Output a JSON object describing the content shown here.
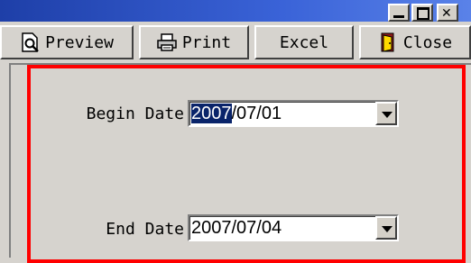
{
  "toolbar": {
    "preview_label": "Preview",
    "print_label": "Print",
    "excel_label": "Excel",
    "close_label": "Close"
  },
  "form": {
    "begin_date": {
      "label": "Begin Date",
      "value_selected": "2007",
      "value_rest": "/07/01"
    },
    "end_date": {
      "label": "End Date",
      "value": "2007/07/04"
    }
  },
  "colors": {
    "title_bar": "#1e3fa8",
    "highlight_border": "#ff0000",
    "selection": "#0a246a"
  },
  "icons": [
    "preview-icon",
    "print-icon",
    "close-door-icon",
    "dropdown-arrow-icon",
    "minimize-icon",
    "maximize-icon",
    "window-close-icon"
  ]
}
